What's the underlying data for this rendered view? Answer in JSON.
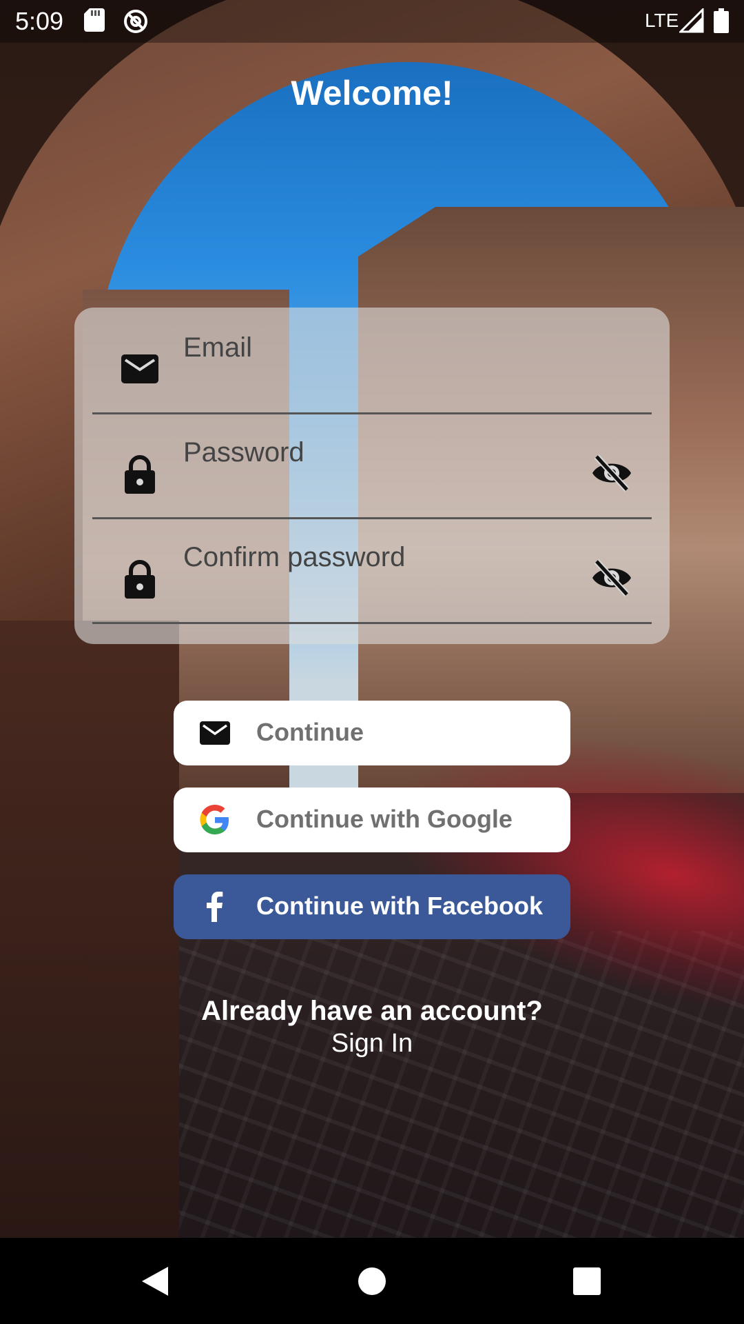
{
  "status_bar": {
    "time": "5:09",
    "network": "LTE",
    "icons": [
      "sd-card-icon",
      "sync-disabled-icon",
      "signal-icon",
      "battery-icon"
    ]
  },
  "title": "Welcome!",
  "form": {
    "email_placeholder": "Email",
    "password_placeholder": "Password",
    "confirm_password_placeholder": "Confirm password",
    "icons": [
      "mail-icon",
      "lock-icon",
      "eye-off-icon"
    ]
  },
  "buttons": {
    "continue_label": "Continue",
    "google_label": "Continue with Google",
    "facebook_label": "Continue with Facebook"
  },
  "footer": {
    "already_text": "Already have an account?",
    "sign_in_label": "Sign In"
  },
  "colors": {
    "facebook_blue": "#3b5998",
    "card_overlay": "#dcdcdc",
    "button_text_gray": "#707070"
  },
  "nav_bar": {
    "icons": [
      "back-icon",
      "home-icon",
      "recent-apps-icon"
    ]
  }
}
